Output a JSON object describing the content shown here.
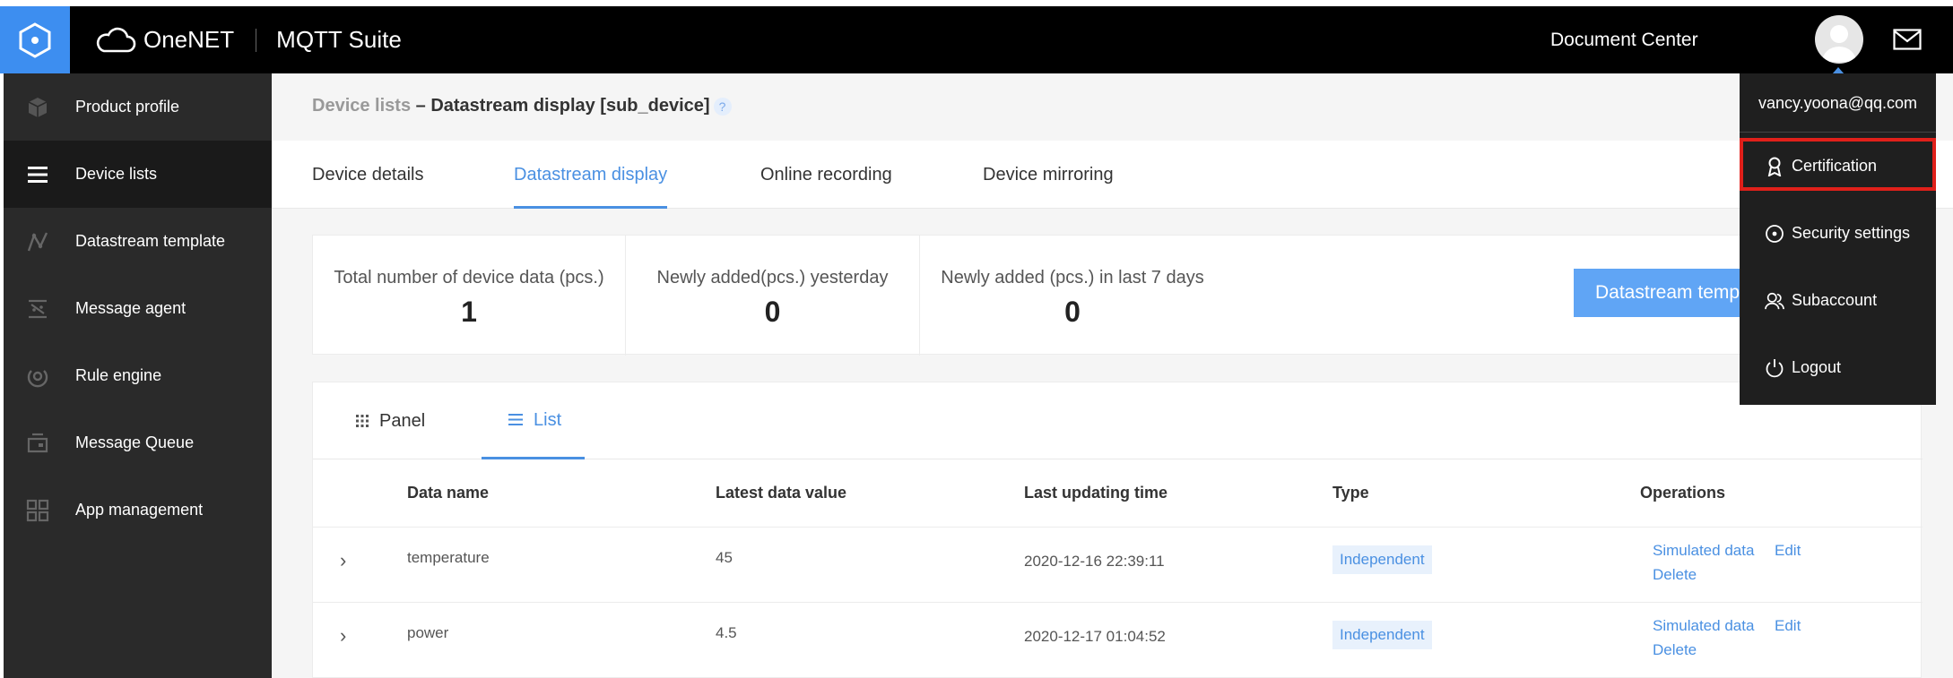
{
  "header": {
    "brand": "OneNET",
    "suite": "MQTT Suite",
    "doc_center": "Document Center"
  },
  "sidebar": {
    "items": [
      {
        "label": "Product profile",
        "icon": "cube-icon"
      },
      {
        "label": "Device lists",
        "icon": "list-icon",
        "active": true
      },
      {
        "label": "Datastream template",
        "icon": "datastream-icon"
      },
      {
        "label": "Message agent",
        "icon": "message-agent-icon"
      },
      {
        "label": "Rule engine",
        "icon": "rule-engine-icon"
      },
      {
        "label": "Message Queue",
        "icon": "message-queue-icon"
      },
      {
        "label": "App management",
        "icon": "app-grid-icon"
      }
    ]
  },
  "breadcrumb": {
    "parent": "Device lists",
    "separator": " – ",
    "current": "Datastream display [sub_device]",
    "help": "?"
  },
  "tabs": [
    {
      "label": "Device details"
    },
    {
      "label": "Datastream display",
      "active": true
    },
    {
      "label": "Online recording"
    },
    {
      "label": "Device mirroring"
    }
  ],
  "stats": [
    {
      "label": "Total number of device data (pcs.)",
      "value": "1"
    },
    {
      "label": "Newly added(pcs.) yesterday",
      "value": "0"
    },
    {
      "label": "Newly added (pcs.) in last 7 days",
      "value": "0"
    }
  ],
  "datastream_button": "Datastream template",
  "view_tabs": [
    {
      "label": "Panel",
      "icon": "grid-dots-icon"
    },
    {
      "label": "List",
      "icon": "list-lines-icon",
      "active": true
    }
  ],
  "table": {
    "headers": [
      "Data name",
      "Latest data value",
      "Last updating time",
      "Type",
      "Operations"
    ],
    "rows": [
      {
        "name": "temperature",
        "value": "45",
        "time": "2020-12-16 22:39:11",
        "type": "Independent",
        "ops": [
          "Simulated data",
          "Edit",
          "Delete"
        ]
      },
      {
        "name": "power",
        "value": "4.5",
        "time": "2020-12-17 01:04:52",
        "type": "Independent",
        "ops": [
          "Simulated data",
          "Edit",
          "Delete"
        ]
      }
    ]
  },
  "user_menu": {
    "email": "vancy.yoona@qq.com",
    "items": [
      {
        "label": "Certification",
        "icon": "certification-icon",
        "highlighted": true
      },
      {
        "label": "Security settings",
        "icon": "security-icon"
      },
      {
        "label": "Subaccount",
        "icon": "subaccount-icon"
      },
      {
        "label": "Logout",
        "icon": "power-icon"
      }
    ]
  },
  "colors": {
    "accent": "#4a90e2",
    "topbar": "#000000",
    "sidebar": "#2a2a2a",
    "highlight": "#e0201a"
  }
}
